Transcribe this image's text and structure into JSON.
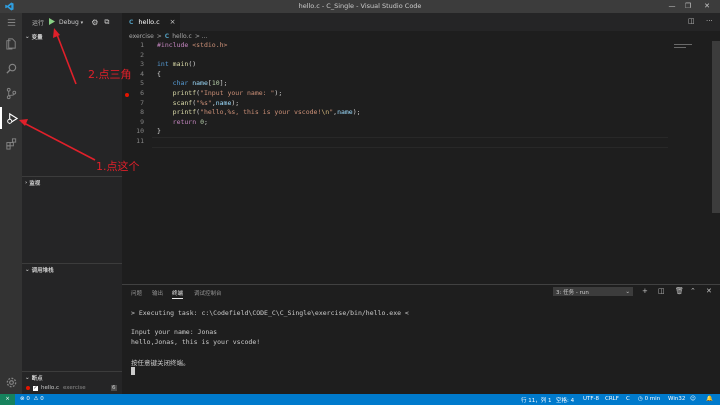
{
  "window": {
    "title": "hello.c - C_Single - Visual Studio Code"
  },
  "window_controls": {
    "min": "—",
    "max": "❐",
    "close": "✕"
  },
  "sidebar": {
    "run_label": "运行",
    "config_name": "Debug",
    "sections": {
      "variables": "变量",
      "watch": "监视",
      "call_stack": "调用堆栈",
      "breakpoints": "断点"
    },
    "breakpoint_item": {
      "file": "hello.c",
      "folder": "exercise",
      "line": "6"
    }
  },
  "editor": {
    "tab_label": "hello.c",
    "tab_close": "×",
    "breadcrumb": {
      "folder": "exercise",
      "sep": ">",
      "file": "hello.c",
      "tail": "> ..."
    },
    "lines": [
      {
        "n": "1",
        "tokens": [
          {
            "c": "pp",
            "t": "#include "
          },
          {
            "c": "str",
            "t": "<stdio.h>"
          }
        ]
      },
      {
        "n": "2",
        "tokens": []
      },
      {
        "n": "3",
        "tokens": [
          {
            "c": "kw",
            "t": "int "
          },
          {
            "c": "fn",
            "t": "main"
          },
          {
            "c": "",
            "t": "()"
          }
        ]
      },
      {
        "n": "4",
        "tokens": [
          {
            "c": "",
            "t": "{"
          }
        ]
      },
      {
        "n": "5",
        "tokens": [
          {
            "c": "",
            "t": "    "
          },
          {
            "c": "kw",
            "t": "char "
          },
          {
            "c": "var",
            "t": "name"
          },
          {
            "c": "",
            "t": "["
          },
          {
            "c": "num",
            "t": "10"
          },
          {
            "c": "",
            "t": "];"
          }
        ]
      },
      {
        "n": "6",
        "tokens": [
          {
            "c": "",
            "t": "    "
          },
          {
            "c": "fn",
            "t": "printf"
          },
          {
            "c": "",
            "t": "("
          },
          {
            "c": "str",
            "t": "\"Input your name: \""
          },
          {
            "c": "",
            "t": ");"
          }
        ]
      },
      {
        "n": "7",
        "tokens": [
          {
            "c": "",
            "t": "    "
          },
          {
            "c": "fn",
            "t": "scanf"
          },
          {
            "c": "",
            "t": "("
          },
          {
            "c": "str",
            "t": "\"%s\""
          },
          {
            "c": "",
            "t": ","
          },
          {
            "c": "var",
            "t": "name"
          },
          {
            "c": "",
            "t": ");"
          }
        ]
      },
      {
        "n": "8",
        "tokens": [
          {
            "c": "",
            "t": "    "
          },
          {
            "c": "fn",
            "t": "printf"
          },
          {
            "c": "",
            "t": "("
          },
          {
            "c": "str",
            "t": "\"hello,%s, this is your vscode!"
          },
          {
            "c": "esc",
            "t": "\\n"
          },
          {
            "c": "str",
            "t": "\""
          },
          {
            "c": "",
            "t": ","
          },
          {
            "c": "var",
            "t": "name"
          },
          {
            "c": "",
            "t": ");"
          }
        ]
      },
      {
        "n": "9",
        "tokens": [
          {
            "c": "",
            "t": "    "
          },
          {
            "c": "pp",
            "t": "return "
          },
          {
            "c": "num",
            "t": "0"
          },
          {
            "c": "",
            "t": ";"
          }
        ]
      },
      {
        "n": "10",
        "tokens": [
          {
            "c": "",
            "t": "}"
          }
        ]
      },
      {
        "n": "11",
        "tokens": []
      }
    ]
  },
  "panel": {
    "tabs": [
      "问题",
      "输出",
      "终端",
      "调试控制台"
    ],
    "active_tab_index": 2,
    "task_select": "3: 任务 - run",
    "terminal_lines": [
      "> Executing task: c:\\Codefield\\CODE_C\\C_Single\\exercise/bin/hello.exe <",
      "",
      "Input your name: Jonas",
      "hello,Jonas, this is your vscode!",
      "",
      "按任意键关闭终端。"
    ]
  },
  "statusbar": {
    "errors": "0",
    "warnings": "0",
    "position": "行 11，列 1",
    "spaces": "空格: 4",
    "encoding": "UTF-8",
    "eol": "CRLF",
    "language": "C",
    "time": "0 min",
    "platform": "Win32"
  },
  "annotations": {
    "step2": "2.点三角",
    "step1": "1.点这个"
  },
  "colors": {
    "accent": "#007acc",
    "annotation": "#e0202a",
    "breakpoint": "#e51400"
  }
}
